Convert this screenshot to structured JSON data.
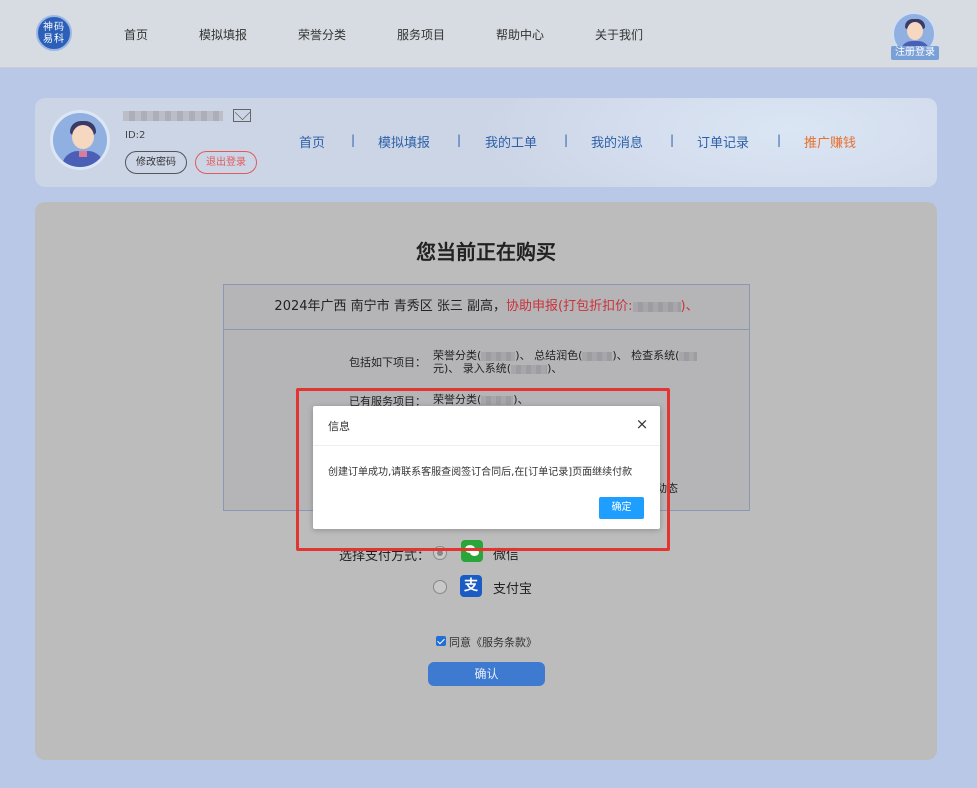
{
  "topnav": {
    "logo_text": "神码\n易科",
    "items": [
      "首页",
      "模拟填报",
      "荣誉分类",
      "服务项目",
      "帮助中心",
      "关于我们"
    ],
    "login_label": "注册登录"
  },
  "user": {
    "id_label": "ID:2",
    "change_password": "修改密码",
    "logout": "退出登录",
    "nav": [
      "首页",
      "模拟填报",
      "我的工单",
      "我的消息",
      "订单记录",
      "推广赚钱"
    ],
    "separator": "|"
  },
  "order": {
    "title": "您当前正在购买",
    "header_prefix": "2024年广西 南宁市 青秀区 张三 副高，",
    "header_red": "协助申报(打包折扣价:",
    "header_red_tail": ")、",
    "includes_label": "包括如下项目：",
    "includes_line1_a": "荣誉分类(",
    "includes_line1_b": ")、 总结润色(",
    "includes_line1_c": ")、 检查系统(",
    "includes_line2_a": "元)、 录入系统(",
    "includes_line2_b": ")、",
    "existing_label": "已有服务项目：",
    "existing_a": "荣誉分类(",
    "existing_b": ")、",
    "partial_text": "动态"
  },
  "payment": {
    "label": "选择支付方式：",
    "options": [
      {
        "name": "微信",
        "selected": true
      },
      {
        "name": "支付宝",
        "selected": false
      }
    ],
    "agree_text": "同意《服务条款》",
    "confirm": "确认"
  },
  "modal": {
    "title": "信息",
    "close": "×",
    "message": "创建订单成功,请联系客服查阅签订合同后,在[订单记录]页面继续付款",
    "ok": "确定"
  },
  "colors": {
    "accent": "#1e9fff",
    "nav_link": "#2d5fa8",
    "promo": "#e7702c",
    "highlight": "#e3342f",
    "wechat": "#2aa539",
    "alipay": "#1a5bc4"
  }
}
